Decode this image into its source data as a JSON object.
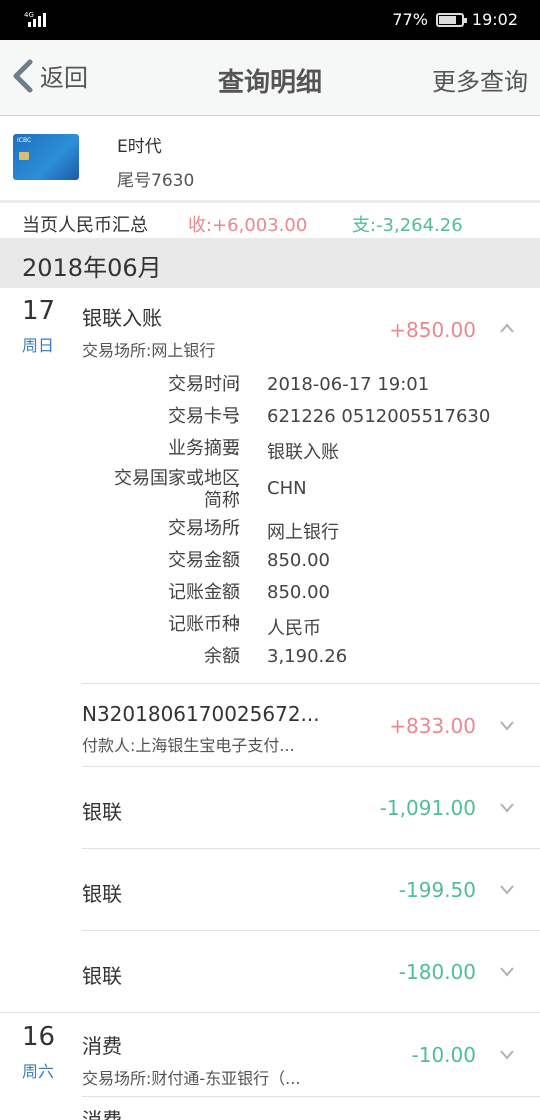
{
  "status_bar": {
    "network": "4G",
    "battery": "77%",
    "battery_level": 0.77,
    "time": "19:02"
  },
  "nav": {
    "back_label": "返回",
    "title": "查询明细",
    "more_label": "更多查询"
  },
  "card": {
    "name": "E时代",
    "tail": "尾号7630",
    "brand": "ICBC"
  },
  "summary": {
    "label": "当页人民币汇总",
    "income": "收:+6,003.00",
    "expense": "支:-3,264.26"
  },
  "month": "2018年06月",
  "colors": {
    "income": "#e9898c",
    "expense": "#4fbf93",
    "weekday": "#3c7fb8"
  },
  "days": [
    {
      "day": "17",
      "weekday": "周日"
    },
    {
      "day": "16",
      "weekday": "周六"
    }
  ],
  "transactions": [
    {
      "title": "银联入账",
      "sub": "交易场所:网上银行",
      "amount": "+850.00",
      "expanded": true
    },
    {
      "title": "N3201806170025672...",
      "sub": "付款人:上海银生宝电子支付...",
      "amount": "+833.00"
    },
    {
      "title": "银联",
      "amount": "-1,091.00"
    },
    {
      "title": "银联",
      "amount": "-199.50"
    },
    {
      "title": "银联",
      "amount": "-180.00"
    },
    {
      "title": "消费",
      "sub": "交易场所:财付通-东亚银行（...",
      "amount": "-10.00"
    },
    {
      "title": "消费"
    }
  ],
  "detail": [
    {
      "k": "交易时间",
      "v": "2018-06-17 19:01"
    },
    {
      "k": "交易卡号",
      "v": "621226 0512005517630"
    },
    {
      "k": "业务摘要",
      "v": "银联入账"
    },
    {
      "k1": "交易国家或地区",
      "k2": "简称",
      "v": "CHN"
    },
    {
      "k": "交易场所",
      "v": "网上银行"
    },
    {
      "k": "交易金额",
      "v": "850.00"
    },
    {
      "k": "记账金额",
      "v": "850.00"
    },
    {
      "k": "记账币种",
      "v": "人民币"
    },
    {
      "k": "余额",
      "v": "3,190.26"
    }
  ],
  "colon": ":"
}
